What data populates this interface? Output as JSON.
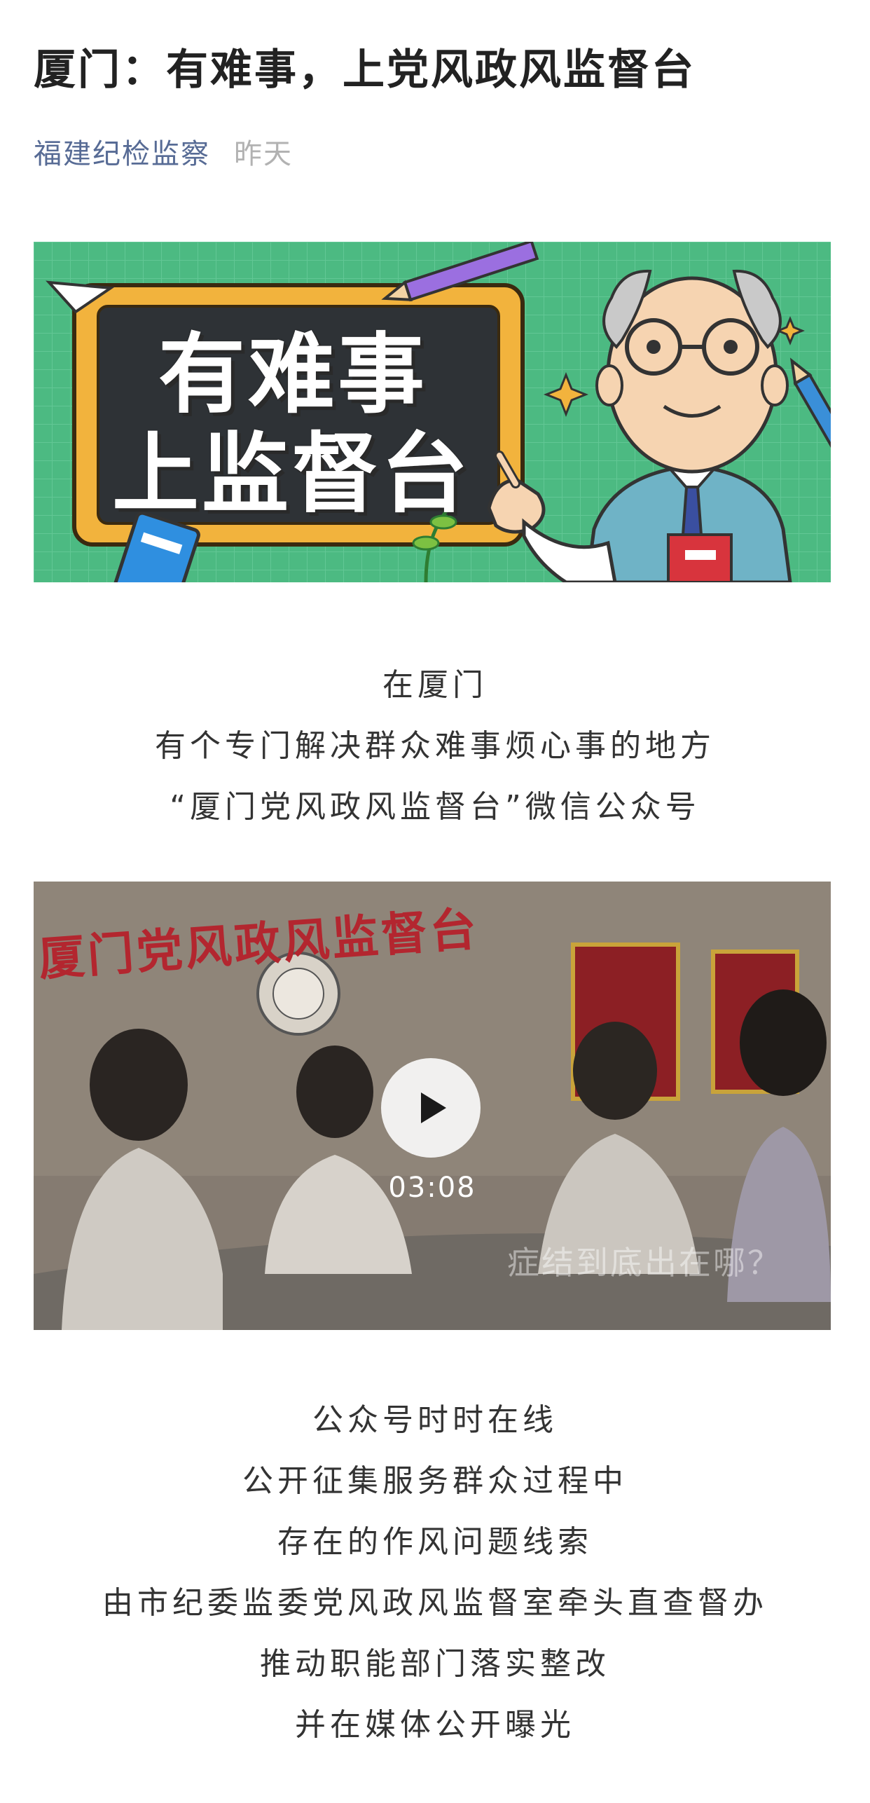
{
  "article": {
    "title": "厦门：有难事，上党风政风监督台",
    "account": "福建纪检监察",
    "date": "昨天"
  },
  "banner": {
    "line1": "有难事",
    "line2": "上监督台"
  },
  "intro": {
    "lines": [
      "在厦门",
      "有个专门解决群众难事烦心事的地方",
      "“厦门党风政风监督台”微信公众号"
    ]
  },
  "video": {
    "duration": "03:08",
    "subtitle": "症结到底出在哪？",
    "wall_text": "厦门党风政风监督台",
    "icon": "play-icon"
  },
  "body": {
    "lines": [
      "公众号时时在线",
      "公开征集服务群众过程中",
      "存在的作风问题线索",
      "由市纪委监委党风政风监督室牵头直查督办",
      "推动职能部门落实整改",
      "并在媒体公开曝光"
    ]
  },
  "colors": {
    "account": "#576b95",
    "date": "#b2b2b2",
    "banner_bg": "#4cba82",
    "board_frame": "#f2b33d",
    "board": "#2e3236"
  }
}
